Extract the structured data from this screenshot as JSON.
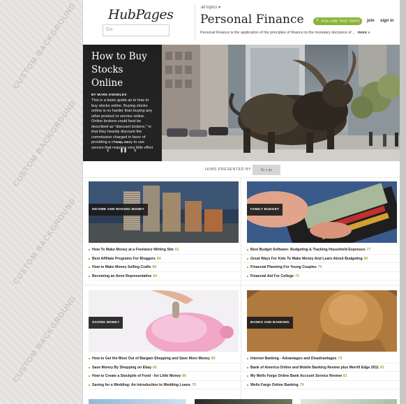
{
  "watermark": "CUSTOM BACKGROUND",
  "header": {
    "logo": "HubPages",
    "search_placeholder": "Go",
    "all_topics": "all topics ▾",
    "topic_title": "Personal Finance",
    "follow_label": "FOLLOW THIS TOPIC",
    "join_label": "join",
    "signin_label": "sign in",
    "description": "Personal Finance is the application of the principles of finance to the monetary decisions of ..",
    "more_label": "more »"
  },
  "hero": {
    "title_line1": "How to Buy",
    "title_line2": "Stocks Online",
    "author": "BY MARK KNOWLES",
    "body": "This is a basic guide as to how to buy stocks online. Buying stocks online is no harder than buying any other product or service online. Online brokers could best be described as \"discount brokers,\" in that they heavily discount the commission charged in favor of providing a cheap, easy to use service that requires very little effort",
    "dots": "●●●●●",
    "prev_icon": "‹",
    "pause_icon": "❚❚",
    "next_icon": "›"
  },
  "presented": {
    "label": "HUBS PRESENTED BY",
    "sponsor": "8o x go"
  },
  "cards": [
    {
      "tag": "INCOME AND MAKING MONEY",
      "items": [
        {
          "text": "How To Make Money at a Freelance Writing Site",
          "score": "81"
        },
        {
          "text": "Best Affiliate Programs For Bloggers",
          "score": "84"
        },
        {
          "text": "How to Make Money Selling Crafts",
          "score": "86"
        },
        {
          "text": "Becoming an Avon Representative",
          "score": "84"
        }
      ]
    },
    {
      "tag": "FAMILY BUDGET",
      "items": [
        {
          "text": "Best Budget Software- Budgeting & Tracking Household Expenses",
          "score": "77"
        },
        {
          "text": "Great Ways For Kids To Make Money And Learn About Budgeting",
          "score": "80"
        },
        {
          "text": "Financial Planning For Young Couples",
          "score": "79"
        },
        {
          "text": "Financial Aid For College",
          "score": "72"
        }
      ]
    },
    {
      "tag": "SAVING MONEY",
      "items": [
        {
          "text": "How to Get the Most Out of Bargain Shopping and Save More Money",
          "score": "80"
        },
        {
          "text": "Save Money By Shopping on Ebay",
          "score": "66"
        },
        {
          "text": "How to Create a Stockpile of Food - for Little Money",
          "score": "86"
        },
        {
          "text": "Saving for a Wedding: An Introduction to Wedding Loans",
          "score": "79"
        }
      ]
    },
    {
      "tag": "BANKS AND BANKING",
      "items": [
        {
          "text": "Internet Banking - Advantages and Disadvantages",
          "score": "79"
        },
        {
          "text": "Bank of America Online and Mobile Banking Review plus Merrill Edge 2011",
          "score": "81"
        },
        {
          "text": "My Wells Fargo Online Bank Account Service Review",
          "score": "81"
        },
        {
          "text": "Wells Fargo Online Banking",
          "score": "79"
        }
      ]
    }
  ],
  "colors": {
    "accent": "#8bb33a",
    "panel": "#1a1a1a"
  }
}
